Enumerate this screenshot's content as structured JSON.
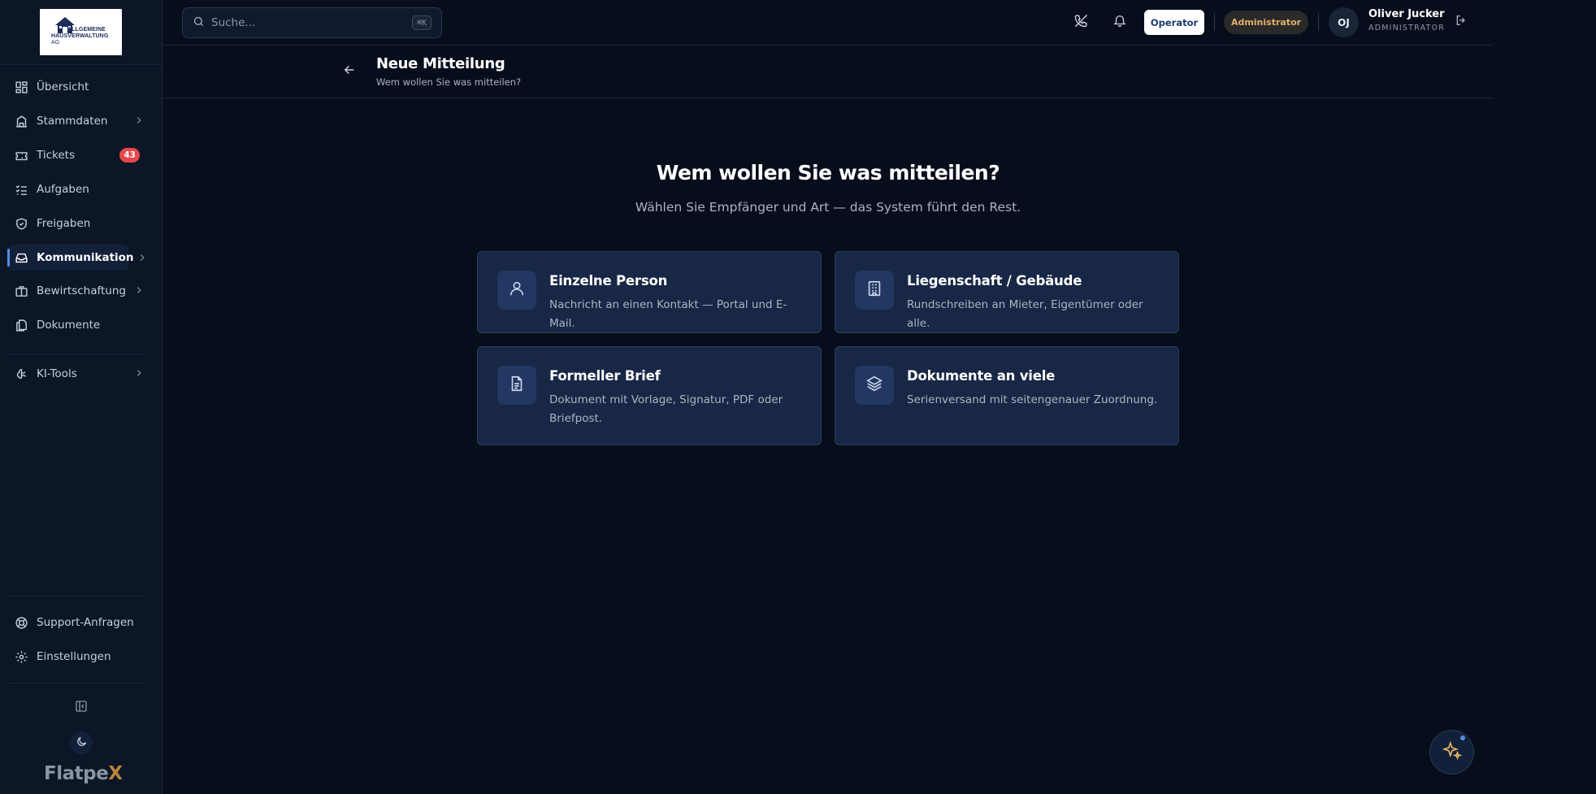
{
  "sidebar": {
    "logo": {
      "line1": "ALLGEMEINE",
      "line2": "HAUSVERWALTUNG",
      "line3": "AG"
    },
    "items": [
      {
        "label": "Übersicht"
      },
      {
        "label": "Stammdaten"
      },
      {
        "label": "Tickets",
        "badge": "43"
      },
      {
        "label": "Aufgaben"
      },
      {
        "label": "Freigaben"
      },
      {
        "label": "Kommunikation"
      },
      {
        "label": "Bewirtschaftung"
      },
      {
        "label": "Dokumente"
      },
      {
        "label": "KI-Tools"
      }
    ],
    "footer_items": [
      {
        "label": "Support-Anfragen"
      },
      {
        "label": "Einstellungen"
      }
    ],
    "brand": {
      "main": "Flatpe",
      "accent": "X"
    }
  },
  "topbar": {
    "search_placeholder": "Suche...",
    "search_shortcut": "⌘K",
    "operator_label": "Operator",
    "role_label": "Administrator",
    "user": {
      "initials": "OJ",
      "name": "Oliver Jucker",
      "role": "ADMINISTRATOR"
    }
  },
  "page": {
    "title": "Neue Mitteilung",
    "subtitle": "Wem wollen Sie was mitteilen?"
  },
  "hero": {
    "title": "Wem wollen Sie was mitteilen?",
    "subtitle": "Wählen Sie Empfänger und Art — das System führt den Rest."
  },
  "cards": [
    {
      "title": "Einzelne Person",
      "desc": "Nachricht an einen Kontakt — Portal und E-Mail.",
      "icon": "user-icon"
    },
    {
      "title": "Liegenschaft / Gebäude",
      "desc": "Rundschreiben an Mieter, Eigentümer oder alle.",
      "icon": "building-icon"
    },
    {
      "title": "Formeller Brief",
      "desc": "Dokument mit Vorlage, Signatur, PDF oder Briefpost.",
      "icon": "document-icon"
    },
    {
      "title": "Dokumente an viele",
      "desc": "Serienversand mit seitengenauer Zuordnung.",
      "icon": "layers-icon"
    }
  ],
  "colors": {
    "background": "#070e1b",
    "sidebar": "#0c1626",
    "card": "#182745",
    "accent": "#4f8fe0",
    "badge": "#e5484d",
    "role_text": "#e2b06a"
  }
}
